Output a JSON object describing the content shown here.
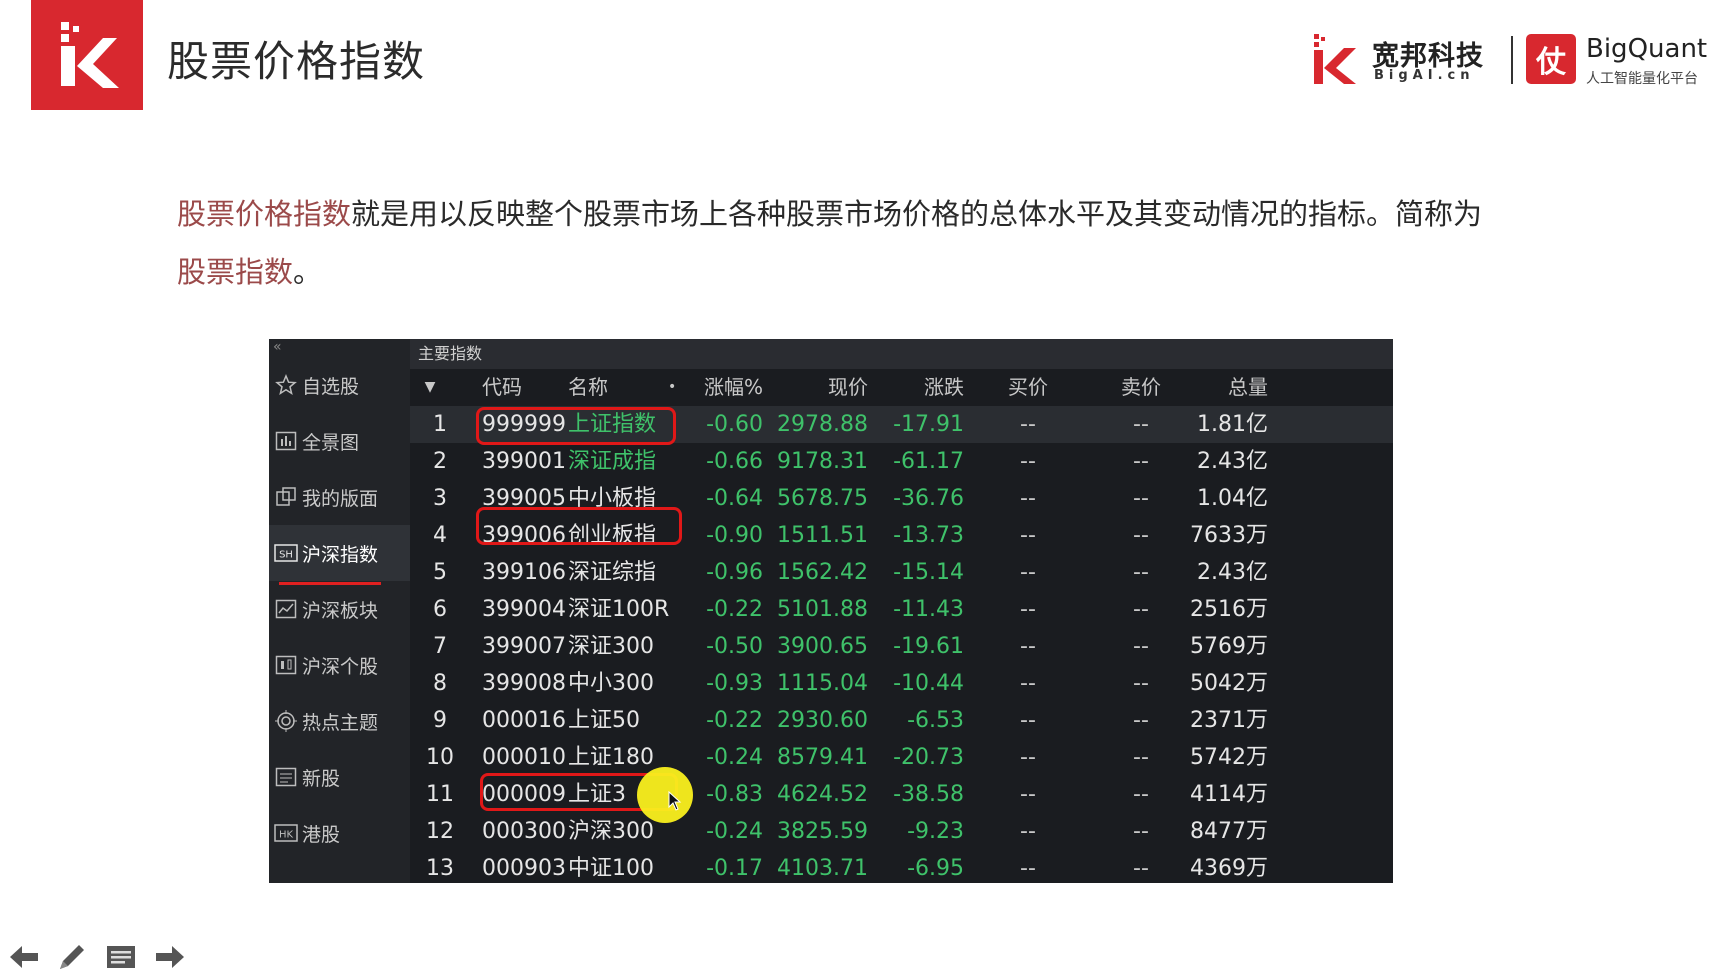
{
  "header": {
    "title": "股票价格指数",
    "brand_primary_cn": "宽邦科技",
    "brand_primary_en": "BigAI.cn",
    "brand_secondary_mark": "仗",
    "brand_secondary_en": "BigQuant",
    "brand_secondary_cn": "人工智能量化平台",
    "accent_color": "#d8282f"
  },
  "intro": {
    "term": "股票价格指数",
    "body": "就是用以反映整个股票市场上各种股票市场价格的总体水平及其变动情况的指标。简称为",
    "alias": "股票指数",
    "end": "。"
  },
  "app": {
    "collapse_glyph": "«",
    "panel_title": "主要指数",
    "sidebar": [
      {
        "label": "自选股",
        "icon": "star-icon"
      },
      {
        "label": "全景图",
        "icon": "bar-chart-icon"
      },
      {
        "label": "我的版面",
        "icon": "layout-icon"
      },
      {
        "label": "沪深指数",
        "icon": "sh-badge-icon",
        "active": true
      },
      {
        "label": "沪深板块",
        "icon": "trend-chart-icon"
      },
      {
        "label": "沪深个股",
        "icon": "candlestick-icon"
      },
      {
        "label": "热点主题",
        "icon": "target-icon"
      },
      {
        "label": "新股",
        "icon": "list-icon"
      },
      {
        "label": "港股",
        "icon": "hk-badge-icon"
      }
    ],
    "columns": {
      "sort": "▼",
      "code": "代码",
      "name": "名称",
      "dot": "•",
      "pct": "涨幅%",
      "price": "现价",
      "change": "涨跌",
      "bid": "买价",
      "ask": "卖价",
      "volume": "总量"
    },
    "rows": [
      {
        "no": "1",
        "code": "999999",
        "name": "上证指数",
        "pct": "-0.60",
        "price": "2978.88",
        "change": "-17.91",
        "bid": "--",
        "ask": "--",
        "volume": "1.81亿"
      },
      {
        "no": "2",
        "code": "399001",
        "name": "深证成指",
        "pct": "-0.66",
        "price": "9178.31",
        "change": "-61.17",
        "bid": "--",
        "ask": "--",
        "volume": "2.43亿"
      },
      {
        "no": "3",
        "code": "399005",
        "name": "中小板指",
        "pct": "-0.64",
        "price": "5678.75",
        "change": "-36.76",
        "bid": "--",
        "ask": "--",
        "volume": "1.04亿"
      },
      {
        "no": "4",
        "code": "399006",
        "name": "创业板指",
        "pct": "-0.90",
        "price": "1511.51",
        "change": "-13.73",
        "bid": "--",
        "ask": "--",
        "volume": "7633万"
      },
      {
        "no": "5",
        "code": "399106",
        "name": "深证综指",
        "pct": "-0.96",
        "price": "1562.42",
        "change": "-15.14",
        "bid": "--",
        "ask": "--",
        "volume": "2.43亿"
      },
      {
        "no": "6",
        "code": "399004",
        "name": "深证100R",
        "pct": "-0.22",
        "price": "5101.88",
        "change": "-11.43",
        "bid": "--",
        "ask": "--",
        "volume": "2516万"
      },
      {
        "no": "7",
        "code": "399007",
        "name": "深证300",
        "pct": "-0.50",
        "price": "3900.65",
        "change": "-19.61",
        "bid": "--",
        "ask": "--",
        "volume": "5769万"
      },
      {
        "no": "8",
        "code": "399008",
        "name": "中小300",
        "pct": "-0.93",
        "price": "1115.04",
        "change": "-10.44",
        "bid": "--",
        "ask": "--",
        "volume": "5042万"
      },
      {
        "no": "9",
        "code": "000016",
        "name": "上证50",
        "pct": "-0.22",
        "price": "2930.60",
        "change": "-6.53",
        "bid": "--",
        "ask": "--",
        "volume": "2371万"
      },
      {
        "no": "10",
        "code": "000010",
        "name": "上证180",
        "pct": "-0.24",
        "price": "8579.41",
        "change": "-20.73",
        "bid": "--",
        "ask": "--",
        "volume": "5742万"
      },
      {
        "no": "11",
        "code": "000009",
        "name": "上证3",
        "pct": "-0.83",
        "price": "4624.52",
        "change": "-38.58",
        "bid": "--",
        "ask": "--",
        "volume": "4114万"
      },
      {
        "no": "12",
        "code": "000300",
        "name": "沪深300",
        "pct": "-0.24",
        "price": "3825.59",
        "change": "-9.23",
        "bid": "--",
        "ask": "--",
        "volume": "8477万"
      },
      {
        "no": "13",
        "code": "000903",
        "name": "中证100",
        "pct": "-0.17",
        "price": "4103.71",
        "change": "-6.95",
        "bid": "--",
        "ask": "--",
        "volume": "4369万"
      }
    ],
    "colors": {
      "down": "#3fc26a",
      "highlight_box": "#e01818",
      "cursor_halo": "#faf01e"
    }
  },
  "bottom_nav": {
    "icons": [
      "arrow-left-icon",
      "pen-icon",
      "menu-icon",
      "arrow-right-icon"
    ]
  }
}
